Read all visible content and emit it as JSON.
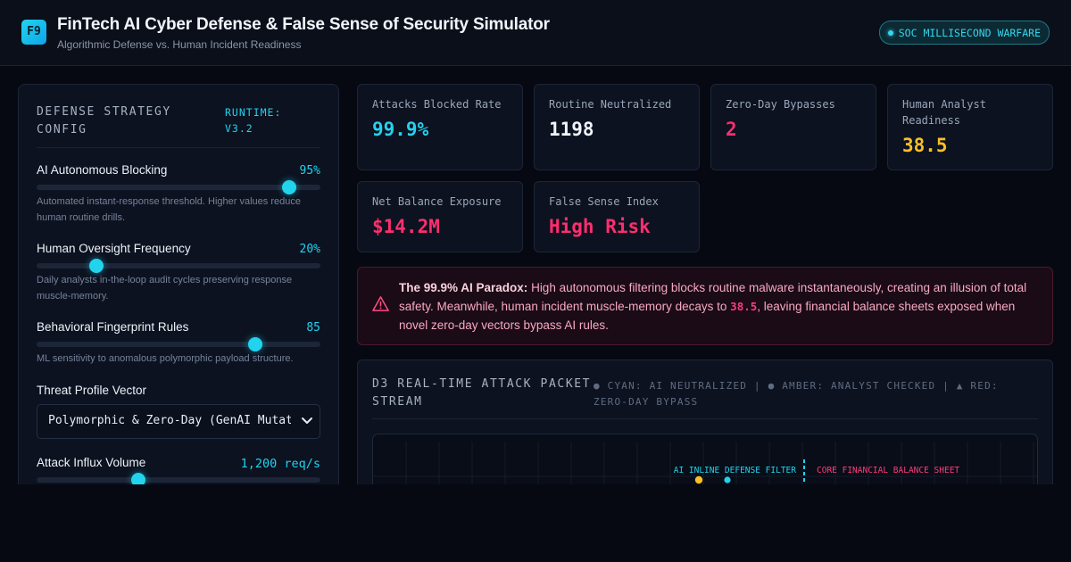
{
  "header": {
    "logo_text": "F9",
    "title": "FinTech AI Cyber Defense & False Sense of Security Simulator",
    "subtitle": "Algorithmic Defense vs. Human Incident Readiness",
    "status_badge": "SOC MILLISECOND WARFARE"
  },
  "config": {
    "title": "DEFENSE STRATEGY CONFIG",
    "runtime": "RUNTIME: V3.2",
    "controls": [
      {
        "label": "AI Autonomous Blocking",
        "value_text": "95%",
        "level": 0.89,
        "description": "Automated instant-response threshold. Higher values reduce human routine drills."
      },
      {
        "label": "Human Oversight Frequency",
        "value_text": "20%",
        "level": 0.21,
        "description": "Daily analysts in-the-loop audit cycles preserving response muscle-memory."
      },
      {
        "label": "Behavioral Fingerprint Rules",
        "value_text": "85",
        "level": 0.77,
        "description": "ML sensitivity to anomalous polymorphic payload structure."
      }
    ],
    "threat_profile": {
      "label": "Threat Profile Vector",
      "selected": "Polymorphic & Zero-Day (GenAI Mutated)"
    },
    "attack_influx": {
      "label": "Attack Influx Volume",
      "value_text": "1,200 req/s",
      "level": 0.36
    }
  },
  "metrics": [
    {
      "label": "Attacks Blocked Rate",
      "value": "99.9%",
      "color": "#22d3ee"
    },
    {
      "label": "Routine Neutralized",
      "value": "1198",
      "color": "#f1f5fb"
    },
    {
      "label": "Zero-Day Bypasses",
      "value": "2",
      "color": "#ff2e6e"
    },
    {
      "label": "Human Analyst Readiness",
      "value": "38.5",
      "color": "#fbbf24"
    },
    {
      "label": "Net Balance Exposure",
      "value": "$14.2M",
      "color": "#ff2e6e"
    },
    {
      "label": "False Sense Index",
      "value": "High Risk",
      "color": "#ff2e6e"
    }
  ],
  "alert": {
    "heading": "The 99.9% AI Paradox:",
    "text_before": " High autonomous filtering blocks routine malware instantaneously, creating an illusion of total safety. Meanwhile, human incident muscle-memory decays to ",
    "highlight": "38.5",
    "text_after": ", leaving financial balance sheets exposed when novel zero-day vectors bypass AI rules."
  },
  "stream": {
    "title": "D3 REAL-TIME ATTACK PACKET STREAM",
    "legend": "● CYAN: AI NEUTRALIZED | ● AMBER: ANALYST CHECKED | ▲ RED: ZERO-DAY BYPASS",
    "filter_label": "AI INLINE DEFENSE FILTER",
    "core_label": "CORE FINANCIAL BALANCE SHEET",
    "colors": {
      "neutralized": "#22d3ee",
      "checked": "#fbbf24",
      "bypass": "#ff2e6e"
    }
  }
}
